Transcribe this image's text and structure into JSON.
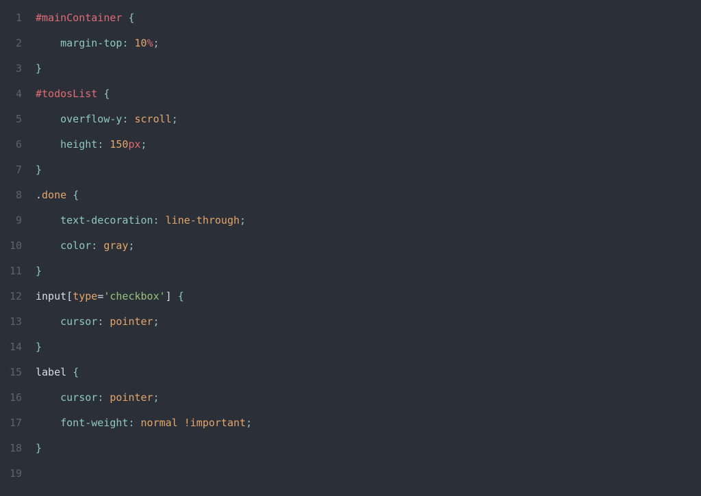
{
  "lines": {
    "1": {
      "num": "1"
    },
    "2": {
      "num": "2"
    },
    "3": {
      "num": "3"
    },
    "4": {
      "num": "4"
    },
    "5": {
      "num": "5"
    },
    "6": {
      "num": "6"
    },
    "7": {
      "num": "7"
    },
    "8": {
      "num": "8"
    },
    "9": {
      "num": "9"
    },
    "10": {
      "num": "10"
    },
    "11": {
      "num": "11"
    },
    "12": {
      "num": "12"
    },
    "13": {
      "num": "13"
    },
    "14": {
      "num": "14"
    },
    "15": {
      "num": "15"
    },
    "16": {
      "num": "16"
    },
    "17": {
      "num": "17"
    },
    "18": {
      "num": "18"
    },
    "19": {
      "num": "19"
    }
  },
  "t": {
    "hash": "#",
    "mainContainer": "mainContainer",
    "sp": " ",
    "lbrace": "{",
    "rbrace": "}",
    "indent": "    ",
    "margin_top": "margin-top",
    "colon_sp": ": ",
    "ten": "10",
    "pct": "%",
    "semi": ";",
    "todosList": "todosList",
    "overflow_y": "overflow-y",
    "scroll": "scroll",
    "height": "height",
    "one_fifty": "150",
    "px": "px",
    "dot": ".",
    "done": "done",
    "text_decoration": "text-decoration",
    "line_through": "line-through",
    "color": "color",
    "gray": "gray",
    "input": "input",
    "lbracket": "[",
    "type": "type",
    "eq": "=",
    "checkbox_str": "'checkbox'",
    "rbracket": "]",
    "cursor": "cursor",
    "pointer": "pointer",
    "label": "label",
    "font_weight": "font-weight",
    "normal": "normal",
    "bang_important": "!important"
  }
}
